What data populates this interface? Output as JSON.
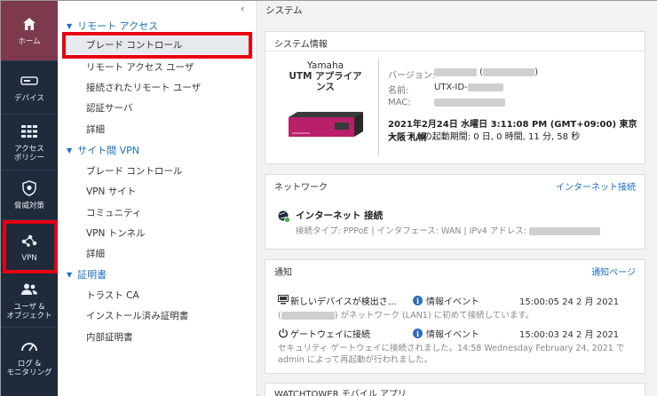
{
  "rail": {
    "items": [
      {
        "label": "ホーム"
      },
      {
        "label": "デバイス"
      },
      {
        "label": "アクセス\nポリシー"
      },
      {
        "label": "脅威対策"
      },
      {
        "label": "VPN"
      },
      {
        "label": "ユーザ &\nオブジェクト"
      },
      {
        "label": "ログ &\nモニタリング"
      }
    ]
  },
  "subnav": {
    "collapse_glyph": "‹",
    "sections": [
      {
        "title": "リモート アクセス",
        "items": [
          "ブレード コントロール",
          "リモート アクセス ユーザ",
          "接続されたリモート ユーザ",
          "認証サーバ",
          "詳細"
        ]
      },
      {
        "title": "サイト間 VPN",
        "items": [
          "ブレード コントロール",
          "VPN サイト",
          "コミュニティ",
          "VPN トンネル",
          "詳細"
        ]
      },
      {
        "title": "証明書",
        "items": [
          "トラスト CA",
          "インストール済み証明書",
          "内部証明書"
        ]
      }
    ]
  },
  "main": {
    "title": "システム",
    "system": {
      "title": "システム情報",
      "product_line1": "Yamaha",
      "product_line2": "UTM アプライア",
      "product_line3": "ンス",
      "version_label": "バージョン:",
      "name_label": "名前:",
      "name_value": "UTX-ID-",
      "mac_label": "MAC:",
      "datetime": "2021年2月24日 水曜日 3:11:08 PM (GMT+09:00) 東京 大阪 札幌",
      "uptime": "システムの起動期間: 0 日, 0 時間, 11 分, 58 秒"
    },
    "network": {
      "title": "ネットワーク",
      "link": "インターネット接続",
      "status": "インターネット 接続",
      "detail": "接続タイプ: PPPoE | インタフェース: WAN | IPv4 アドレス:"
    },
    "notifications": {
      "title": "通知",
      "link": "通知ページ",
      "events": [
        {
          "title": "新しいデバイスが検出さ…",
          "badge": "情報イベント",
          "time": "15:00:05 24 2 月 2021",
          "desc": "がネットワーク (LAN1) に初めて接続しています。"
        },
        {
          "title": "ゲートウェイに接続",
          "badge": "情報イベント",
          "time": "15:00:03 24 2 月 2021",
          "desc": "セキュリティ ゲートウェイに接続されました。14:58 Wednesday February 24, 2021 で admin によって再起動が行われました。"
        }
      ]
    },
    "watchtower": {
      "title": "WATCHTOWER モバイル アプリ"
    }
  }
}
